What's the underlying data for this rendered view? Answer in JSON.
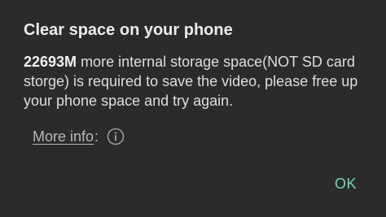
{
  "dialog": {
    "title": "Clear space on your phone",
    "message": {
      "amount": "22693M",
      "text": " more internal storage space(NOT SD card storge) is required to save the video, please free up your phone space and try again."
    },
    "more_info": {
      "label": "More info",
      "separator": ":",
      "icon": "info-icon"
    },
    "ok_label": "OK",
    "colors": {
      "background": "#2b2b2b",
      "accent": "#7fd1b9"
    }
  }
}
